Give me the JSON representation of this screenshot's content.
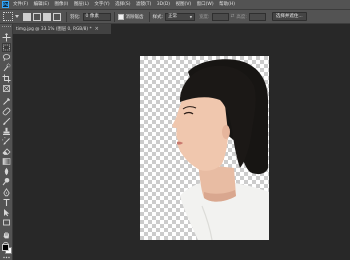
{
  "menubar": {
    "logo": "Ps",
    "items": [
      "文件(F)",
      "编辑(E)",
      "图像(I)",
      "图层(L)",
      "文字(Y)",
      "选择(S)",
      "滤镜(T)",
      "3D(D)",
      "视图(V)",
      "窗口(W)",
      "帮助(H)"
    ]
  },
  "options": {
    "feather_label": "羽化:",
    "feather_value": "0 像素",
    "antialias_label": "消除锯齿",
    "style_label": "样式:",
    "style_value": "正常",
    "width_label": "宽度:",
    "height_label": "高度:",
    "select_subject_button": "选择并遮住..."
  },
  "document": {
    "tab_title": "timg.jpg @ 33.1% (图层 0, RGB/8) *",
    "tab_close": "×"
  },
  "tools": [
    "move-tool",
    "marquee-tool",
    "lasso-tool",
    "quick-select-tool",
    "crop-tool",
    "frame-tool",
    "eyedropper-tool",
    "spot-heal-tool",
    "brush-tool",
    "clone-stamp-tool",
    "history-brush-tool",
    "eraser-tool",
    "gradient-tool",
    "blur-tool",
    "dodge-tool",
    "pen-tool",
    "type-tool",
    "path-select-tool",
    "rectangle-tool",
    "hand-tool",
    "zoom-tool",
    "more-tools"
  ],
  "colors": {
    "foreground": "#000000",
    "background": "#ffffff"
  }
}
